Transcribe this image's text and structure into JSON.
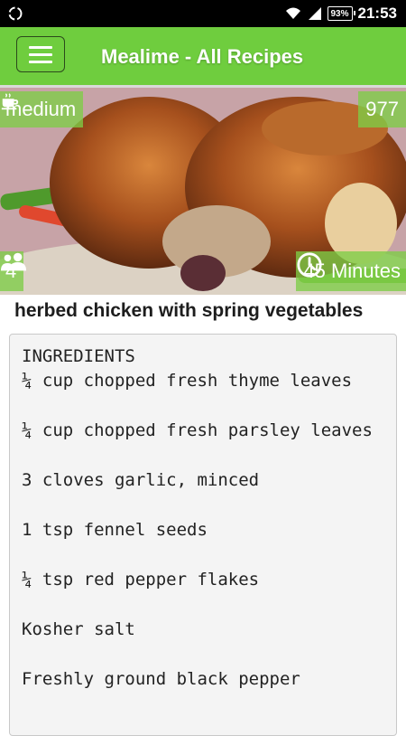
{
  "status_bar": {
    "battery": "93%",
    "time": "21:53",
    "icons": [
      "sync-icon",
      "wifi-icon",
      "signal-icon",
      "battery-icon"
    ]
  },
  "app_bar": {
    "title": "Mealime - All Recipes",
    "menu_icon": "hamburger-menu-icon",
    "color": "#6fcd3e"
  },
  "recipe": {
    "difficulty": "medium",
    "difficulty_icon": "coffee-cup-icon",
    "likes": "977",
    "servings": "4",
    "servings_icon": "people-icon",
    "time": "45 Minutes",
    "time_icon": "clock-icon",
    "title": "herbed chicken with spring vegetables",
    "overlay_color": "#7dcd46"
  },
  "ingredients": {
    "heading": "INGREDIENTS",
    "items": [
      "¼ cup chopped fresh thyme leaves",
      "¼ cup chopped fresh parsley leaves",
      "3 cloves garlic, minced",
      "1 tsp fennel seeds",
      "¼ tsp red pepper flakes",
      "Kosher salt",
      "Freshly ground black pepper"
    ]
  }
}
